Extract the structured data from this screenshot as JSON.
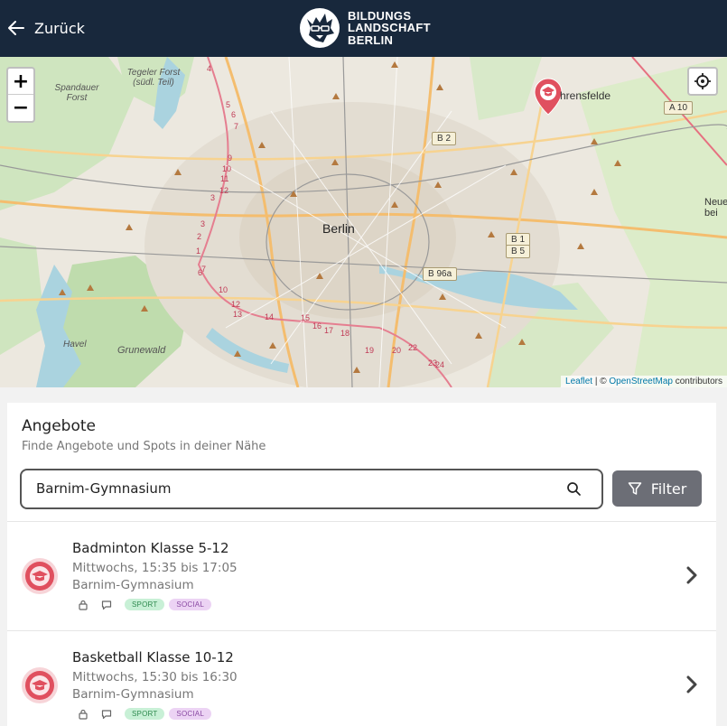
{
  "header": {
    "back_label": "Zurück",
    "logo_lines": [
      "BILDUNGS",
      "LANDSCHAFT",
      "BERLIN"
    ]
  },
  "map": {
    "city_label": "Berlin",
    "place_labels": [
      "Spandauer Forst",
      "Tegeler Forst (südl. Teil)",
      "Grunewald",
      "Havel",
      "hrensfelde",
      "Neue bei"
    ],
    "road_badges": [
      "B 2",
      "A 10",
      "B 1",
      "B 5",
      "B 96a"
    ],
    "route_numbers": [
      "4",
      "5",
      "6",
      "7",
      "9",
      "10",
      "11",
      "12",
      "3",
      "2",
      "1",
      "13",
      "14",
      "15",
      "16",
      "17",
      "18",
      "19",
      "20",
      "22",
      "23",
      "24"
    ],
    "attribution": {
      "leaflet": "Leaflet",
      "sep": " | © ",
      "osm": "OpenStreetMap",
      "suffix": " contributors"
    },
    "zoom_in": "+",
    "zoom_out": "−"
  },
  "panel": {
    "title": "Angebote",
    "subtitle": "Finde Angebote und Spots in deiner Nähe",
    "search_value": "Barnim-Gymnasium",
    "filter_label": "Filter"
  },
  "results": [
    {
      "title": "Badminton Klasse 5-12",
      "time": "Mittwochs, 15:35 bis 17:05",
      "location": "Barnim-Gymnasium",
      "tags": [
        "SPORT",
        "SOCIAL"
      ]
    },
    {
      "title": "Basketball Klasse 10-12",
      "time": "Mittwochs, 15:30 bis 16:30",
      "location": "Barnim-Gymnasium",
      "tags": [
        "SPORT",
        "SOCIAL"
      ]
    }
  ],
  "colors": {
    "header_bg": "#18283c",
    "accent_red": "#e0505f",
    "filter_bg": "#6c6e76",
    "tag_sport_bg": "#c8f0d6",
    "tag_social_bg": "#ecd3f4"
  },
  "icons": {
    "back": "arrow-left-icon",
    "search": "search-icon",
    "filter": "funnel-icon",
    "locate": "crosshair-icon",
    "marker": "graduation-cap-marker-icon",
    "lock": "lock-icon",
    "chat": "chat-icon",
    "chevron": "chevron-right-icon"
  }
}
